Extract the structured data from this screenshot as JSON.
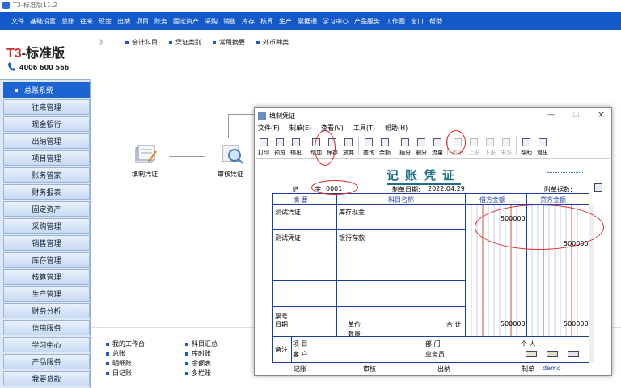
{
  "app": {
    "title": "T3-标准版11.2"
  },
  "menu": [
    "文件",
    "基础设置",
    "总账",
    "往来",
    "现金",
    "出纳",
    "项目",
    "账务",
    "固定资产",
    "采购",
    "销售",
    "库存",
    "核算",
    "生产",
    "票据通",
    "学习中心",
    "产品服务",
    "工作圈",
    "窗口",
    "帮助"
  ],
  "logo": {
    "brand_t3": "T3",
    "brand_rest": "-标准版",
    "phone": "4006 600 566"
  },
  "nav": {
    "header": "总账系统",
    "items": [
      "往来管理",
      "现金银行",
      "出纳管理",
      "项目管理",
      "账务管家",
      "财务报表",
      "固定资产",
      "采购管理",
      "销售管理",
      "库存管理",
      "核算管理",
      "生产管理",
      "财务分析",
      "信用服务",
      "学习中心",
      "产品服务",
      "我要贷款"
    ]
  },
  "tabs": {
    "arrows": "》",
    "items": [
      "会计科目",
      "凭证类别",
      "常用摘要",
      "外币种类"
    ]
  },
  "flow": {
    "fill_label": "填制凭证",
    "review_label": "审核凭证"
  },
  "bottom_links": {
    "col1": [
      "我的工作台",
      "总账",
      "明细账",
      "日记账"
    ],
    "col2": [
      "科目汇总",
      "序时账",
      "余额表",
      "多栏账"
    ]
  },
  "dialog": {
    "title": "填制凭证",
    "controls": {
      "minimize": "—",
      "maximize": "□",
      "close": "×"
    },
    "menu": [
      "文件(F)",
      "制单(E)",
      "查看(V)",
      "工具(T)",
      "帮助(H)"
    ],
    "toolbar": [
      {
        "label": "打印",
        "disabled": false
      },
      {
        "label": "预览",
        "disabled": false
      },
      {
        "label": "输出",
        "disabled": false
      },
      {
        "label": "增加",
        "disabled": false
      },
      {
        "label": "保存",
        "disabled": false
      },
      {
        "label": "放弃",
        "disabled": false
      },
      {
        "label": "查询",
        "disabled": false
      },
      {
        "label": "余额",
        "disabled": false
      },
      {
        "label": "插分",
        "disabled": false
      },
      {
        "label": "删分",
        "disabled": false
      },
      {
        "label": "流量",
        "disabled": false
      },
      {
        "label": "首张",
        "disabled": true
      },
      {
        "label": "上张",
        "disabled": true
      },
      {
        "label": "下张",
        "disabled": true
      },
      {
        "label": "末张",
        "disabled": true
      },
      {
        "label": "帮助",
        "disabled": false
      },
      {
        "label": "退出",
        "disabled": false
      }
    ],
    "voucher": {
      "title": "记账凭证",
      "type_label": "记",
      "number_prefix": "字",
      "number": "0001",
      "date_label": "制单日期:",
      "date": "2022.04.29",
      "attachments_label": "附单据数:",
      "headers": {
        "summary": "摘  要",
        "account": "科目名称",
        "debit": "借方金额",
        "credit": "贷方金额"
      },
      "rows": [
        {
          "summary": "测试凭证",
          "account": "库存现金",
          "debit": "500000",
          "credit": ""
        },
        {
          "summary": "测试凭证",
          "account": "银行存款",
          "debit": "",
          "credit": "500000"
        },
        {
          "summary": "",
          "account": "",
          "debit": "",
          "credit": ""
        },
        {
          "summary": "",
          "account": "",
          "debit": "",
          "credit": ""
        },
        {
          "summary": "",
          "account": "",
          "debit": "",
          "credit": ""
        }
      ],
      "footer": {
        "ticket_label": "票号",
        "date_label": "日期",
        "price_label": "单价",
        "qty_label": "数量",
        "total_label": "合 计",
        "total_debit": "500000",
        "total_credit": "500000",
        "remark_label": "备注",
        "project_label": "项  目",
        "customer_label": "客  户",
        "dept_label": "部  门",
        "salesman_label": "业务员",
        "person_label": "个  人"
      },
      "signatures": {
        "bookkeeper": "记账",
        "reviewer": "审核",
        "cashier": "出纳",
        "maker_label": "制单",
        "maker": "demo"
      }
    }
  },
  "colors": {
    "menubar": "#1459c9",
    "annotation": "#d92a2a"
  }
}
